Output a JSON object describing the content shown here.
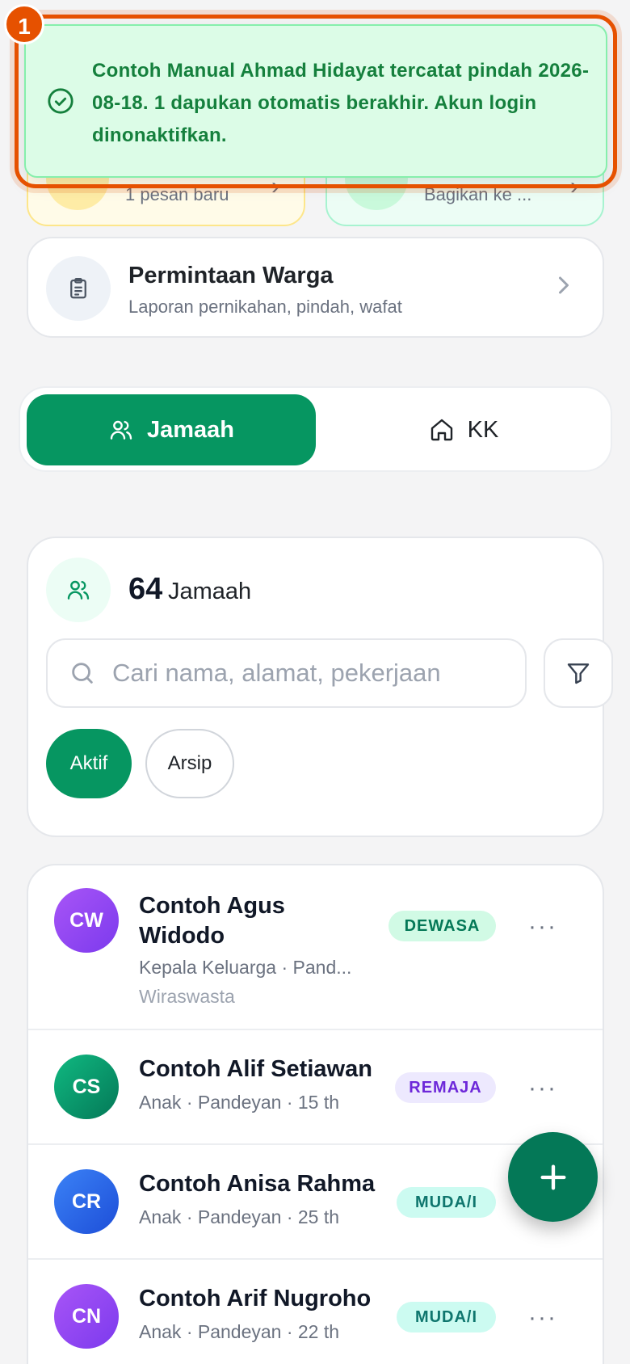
{
  "quick_cards": {
    "messages_sub": "1 pesan baru",
    "share_sub": "Bagikan ke ..."
  },
  "toast": {
    "badge": "1",
    "message": "Contoh Manual Ahmad Hidayat tercatat pindah 2026-08-18. 1 dapukan otomatis berakhir. Akun login dinonaktifkan."
  },
  "requests": {
    "title": "Permintaan Warga",
    "subtitle": "Laporan pernikahan, pindah, wafat"
  },
  "tabs": [
    {
      "label": "Jamaah",
      "active": true
    },
    {
      "label": "KK",
      "active": false
    }
  ],
  "summary": {
    "count": "64",
    "label": "Jamaah",
    "search_placeholder": "Cari nama, alamat, pekerjaan",
    "filters": [
      "Aktif",
      "Arsip"
    ]
  },
  "members": [
    {
      "initials": "CW",
      "name_line1": "Contoh Agus",
      "name_line2": "Widodo",
      "meta": "Kepala Keluarga · Pand...",
      "job": "Wiraswasta",
      "tag": "DEWASA"
    },
    {
      "initials": "CS",
      "name": "Contoh Alif Setiawan",
      "meta": "Anak · Pandeyan · 15 th",
      "tag": "REMAJA"
    },
    {
      "initials": "CR",
      "name": "Contoh Anisa Rahma",
      "meta": "Anak · Pandeyan · 25 th",
      "tag": "MUDA/I"
    },
    {
      "initials": "CN",
      "name": "Contoh Arif Nugroho",
      "meta": "Anak · Pandeyan · 22 th",
      "tag": "MUDA/I"
    }
  ],
  "more_glyph": "···",
  "colors": {
    "primary": "#069661",
    "toast_bg": "#dcfce7",
    "toast_text": "#15803d",
    "highlight": "#e65100"
  }
}
